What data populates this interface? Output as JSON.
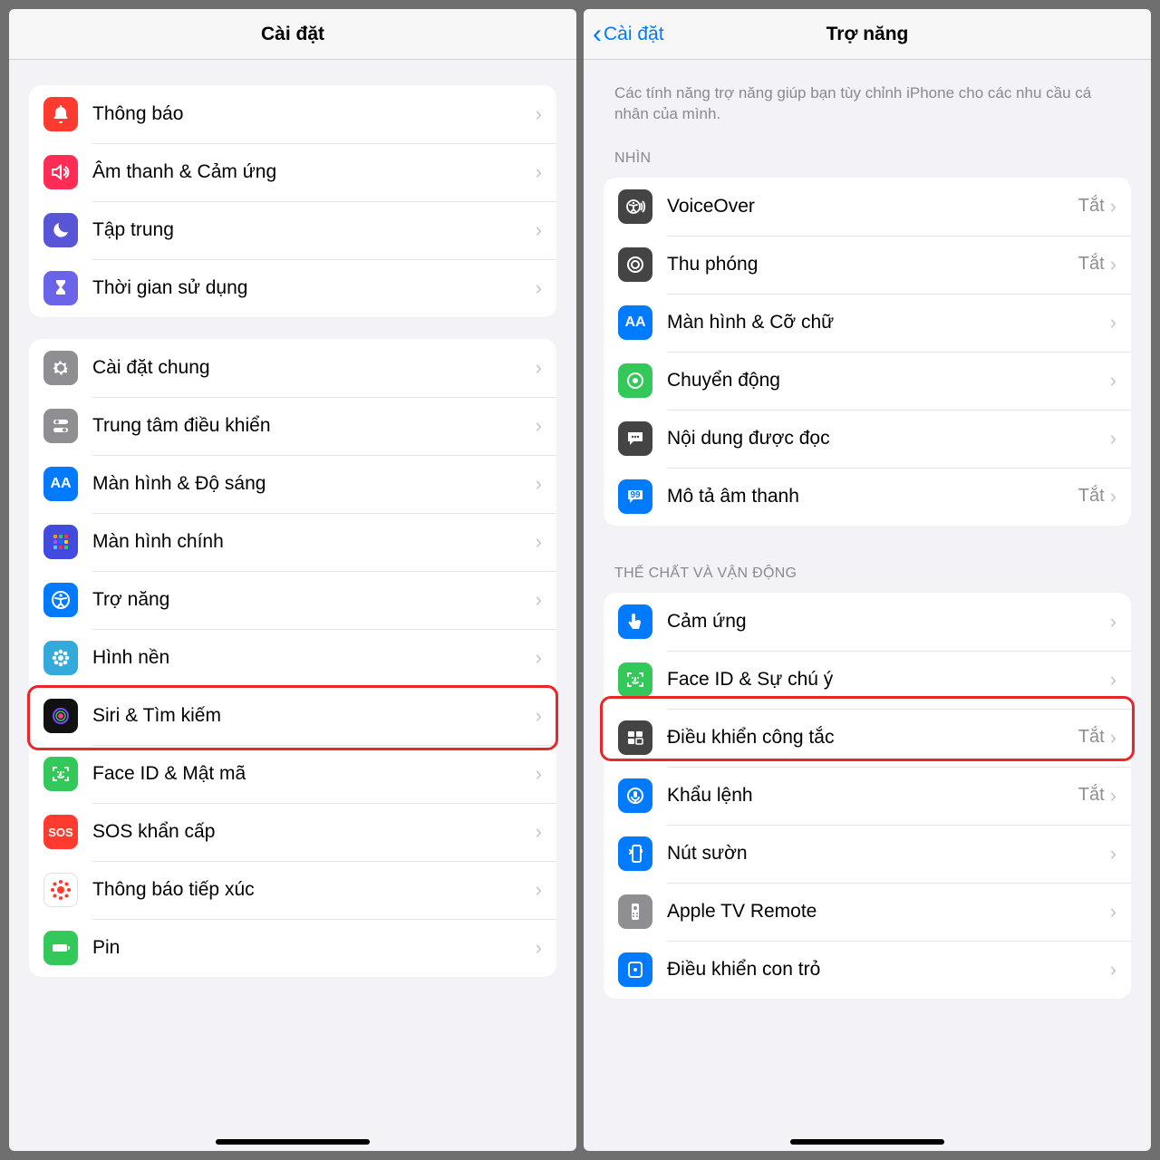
{
  "left": {
    "title": "Cài đặt",
    "group1": [
      {
        "label": "Thông báo"
      },
      {
        "label": "Âm thanh & Cảm ứng"
      },
      {
        "label": "Tập trung"
      },
      {
        "label": "Thời gian sử dụng"
      }
    ],
    "group2": [
      {
        "label": "Cài đặt chung"
      },
      {
        "label": "Trung tâm điều khiển"
      },
      {
        "label": "Màn hình & Độ sáng"
      },
      {
        "label": "Màn hình chính"
      },
      {
        "label": "Trợ năng"
      },
      {
        "label": "Hình nền"
      },
      {
        "label": "Siri & Tìm kiếm"
      },
      {
        "label": "Face ID & Mật mã"
      },
      {
        "label": "SOS khẩn cấp"
      },
      {
        "label": "Thông báo tiếp xúc"
      },
      {
        "label": "Pin"
      }
    ]
  },
  "right": {
    "back": "Cài đặt",
    "title": "Trợ năng",
    "desc": "Các tính năng trợ năng giúp bạn tùy chỉnh iPhone cho các nhu cầu cá nhân của mình.",
    "section1_header": "NHÌN",
    "section1": [
      {
        "label": "VoiceOver",
        "value": "Tắt"
      },
      {
        "label": "Thu phóng",
        "value": "Tắt"
      },
      {
        "label": "Màn hình & Cỡ chữ",
        "value": ""
      },
      {
        "label": "Chuyển động",
        "value": ""
      },
      {
        "label": "Nội dung được đọc",
        "value": ""
      },
      {
        "label": "Mô tả âm thanh",
        "value": "Tắt"
      }
    ],
    "section2_header": "THỂ CHẤT VÀ VẬN ĐỘNG",
    "section2": [
      {
        "label": "Cảm ứng",
        "value": ""
      },
      {
        "label": "Face ID & Sự chú ý",
        "value": ""
      },
      {
        "label": "Điều khiển công tắc",
        "value": "Tắt"
      },
      {
        "label": "Khẩu lệnh",
        "value": "Tắt"
      },
      {
        "label": "Nút sườn",
        "value": ""
      },
      {
        "label": "Apple TV Remote",
        "value": ""
      },
      {
        "label": "Điều khiển con trỏ",
        "value": ""
      }
    ]
  }
}
